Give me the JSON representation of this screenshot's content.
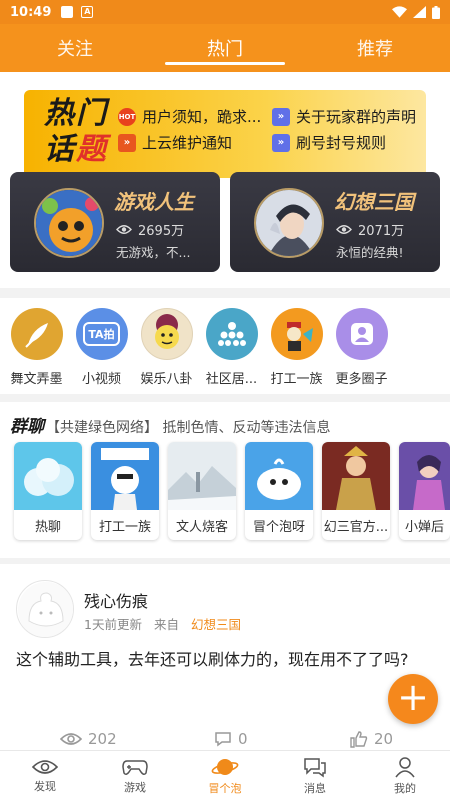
{
  "status": {
    "time": "10:49"
  },
  "topnav": {
    "tabs": [
      "关注",
      "热门",
      "推荐"
    ],
    "active": 1
  },
  "banner": {
    "title_line1": "热门",
    "title_line2a": "话",
    "title_line2b": "题",
    "items": [
      {
        "text": "用户须知，跪求...",
        "icon": "hot-icon"
      },
      {
        "text": "关于玩家群的声明",
        "icon": "arrow-icon"
      },
      {
        "text": "上云维护通知",
        "icon": "arrow-icon"
      },
      {
        "text": "刷号封号规则",
        "icon": "arrow-icon"
      }
    ],
    "hot_badge": "HOT"
  },
  "games": [
    {
      "name": "游戏人生",
      "views": "2695万",
      "desc": "无游戏，不..."
    },
    {
      "name": "幻想三国",
      "views": "2071万",
      "desc": "永恒的经典!"
    }
  ],
  "circles": [
    {
      "label": "舞文弄墨",
      "color": "#e0a531"
    },
    {
      "label": "小视频",
      "color": "#5b8fe6",
      "badge": "TA拍"
    },
    {
      "label": "娱乐八卦",
      "color": "#f0e3c8"
    },
    {
      "label": "社区居...",
      "color": "#4aa6c8"
    },
    {
      "label": "打工一族",
      "color": "#f39a1f"
    },
    {
      "label": "更多圈子",
      "color": "#a98ee8"
    }
  ],
  "groups": {
    "title": "群聊",
    "subtitle": "【共建绿色网络】 抵制色情、反动等违法信息",
    "items": [
      {
        "label": "热聊"
      },
      {
        "label": "打工一族"
      },
      {
        "label": "文人烧客"
      },
      {
        "label": "冒个泡呀"
      },
      {
        "label": "幻三官方..."
      },
      {
        "label": "小婵后"
      }
    ]
  },
  "post": {
    "author": "残心伤痕",
    "time": "1天前更新",
    "from": "来自",
    "tag": "幻想三国",
    "text": "这个辅助工具，去年还可以刷体力的，现在用不了了吗?",
    "views": "202",
    "comments": "0",
    "likes": "20"
  },
  "fab": {
    "label": "+"
  },
  "bottomnav": {
    "items": [
      {
        "label": "发现",
        "icon": "eye-icon"
      },
      {
        "label": "游戏",
        "icon": "gamepad-icon"
      },
      {
        "label": "冒个泡",
        "icon": "planet-icon"
      },
      {
        "label": "消息",
        "icon": "chat-icon"
      },
      {
        "label": "我的",
        "icon": "user-icon"
      }
    ],
    "active": 2
  },
  "colors": {
    "accent": "#f5921c",
    "dark_card": "#2f2f38",
    "gold_text": "#f1c27b"
  }
}
